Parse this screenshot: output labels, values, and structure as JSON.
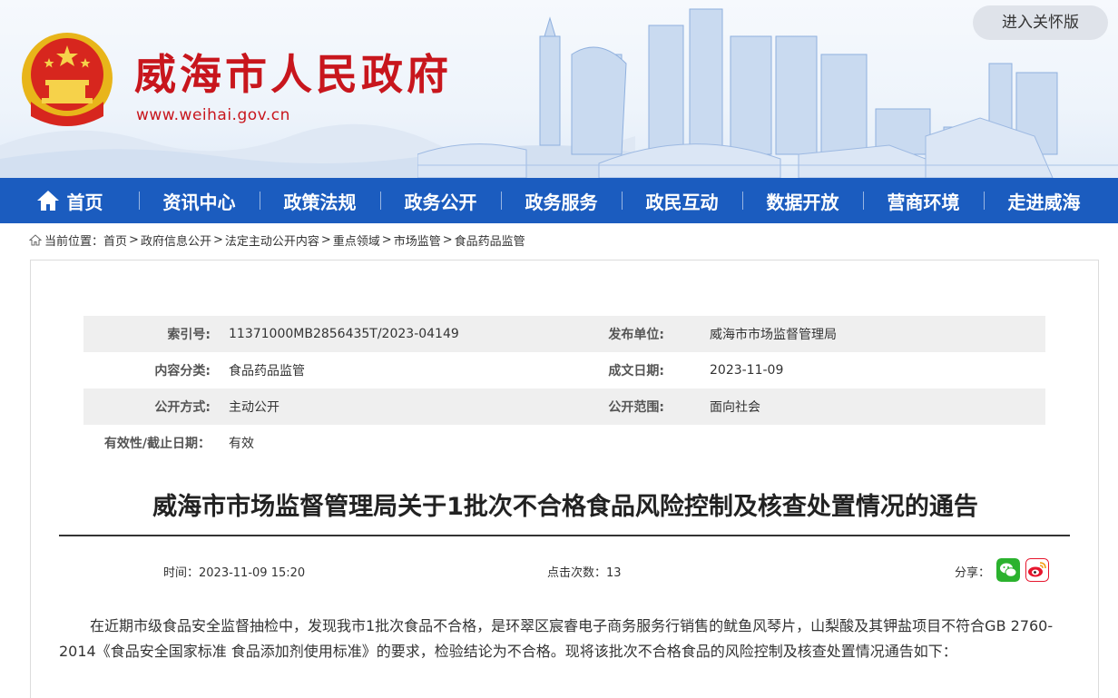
{
  "header": {
    "title": "威海市人民政府",
    "url": "www.weihai.gov.cn",
    "care_button": "进入关怀版"
  },
  "nav": {
    "items": [
      {
        "label": "首页",
        "icon": "home-icon"
      },
      {
        "label": "资讯中心"
      },
      {
        "label": "政策法规"
      },
      {
        "label": "政务公开"
      },
      {
        "label": "政务服务"
      },
      {
        "label": "政民互动"
      },
      {
        "label": "数据开放"
      },
      {
        "label": "营商环境"
      },
      {
        "label": "走进威海"
      }
    ]
  },
  "breadcrumb": {
    "prefix": "当前位置：",
    "items": [
      "首页",
      "政府信息公开",
      "法定主动公开内容",
      "重点领域",
      "市场监管",
      "食品药品监管"
    ]
  },
  "meta": {
    "index_label": "索引号:",
    "index_value": "11371000MB2856435T/2023-04149",
    "publisher_label": "发布单位:",
    "publisher_value": "威海市市场监督管理局",
    "category_label": "内容分类:",
    "category_value": "食品药品监管",
    "date_label": "成文日期:",
    "date_value": "2023-11-09",
    "method_label": "公开方式:",
    "method_value": "主动公开",
    "scope_label": "公开范围:",
    "scope_value": "面向社会",
    "validity_label": "有效性/截止日期：",
    "validity_value": "有效"
  },
  "article": {
    "title": "威海市市场监督管理局关于1批次不合格食品风险控制及核查处置情况的通告",
    "time_label": "时间：",
    "time_value": "2023-11-09 15:20",
    "views_label": "点击次数：",
    "views_value": "13",
    "share_label": "分享：",
    "body": "在近期市级食品安全监督抽检中，发现我市1批次食品不合格，是环翠区宸睿电子商务服务行销售的鱿鱼风琴片，山梨酸及其钾盐项目不符合GB 2760-2014《食品安全国家标准 食品添加剂使用标准》的要求，检验结论为不合格。现将该批次不合格食品的风险控制及核查处置情况通告如下："
  },
  "colors": {
    "brand_red": "#c8161d",
    "nav_blue": "#1b5cbf",
    "wechat_green": "#2bb22e",
    "weibo_red": "#e6162d"
  }
}
